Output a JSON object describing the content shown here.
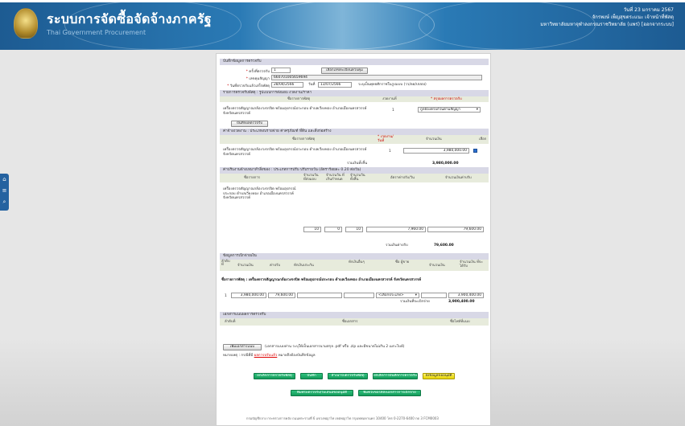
{
  "header": {
    "title": "ระบบการจัดซื้อจัดจ้างภาครัฐ",
    "subtitle": "Thai Government Procurement",
    "date_line": "วันที่ 23 มกราคม 2567",
    "user_line": "จักรพงษ์ เพ็ญสุขตระแนะ  เจ้าหน้าที่พัสดุ",
    "org_line": "มหาวิทยาลัยมหาจุฬาลงกรณราชวิทยาลัย (แพร่) [ออกจากระบบ]"
  },
  "side_tab": {
    "home": "⌂",
    "menu": "≡",
    "search": "⌕"
  },
  "record": {
    "section_title": "บันทึกข้อมูลการตรวจรับ",
    "round_label": "ครั้งที่ตรวจรับ",
    "round_value": "1",
    "select_btn": "เลือกเลขทะเบียนควบคุม",
    "contract_label": "เลขคุมสัญญา",
    "contract_value": "660701005659694",
    "date_label": "วันที่ตรวจรับแล้วเสร็จพัสดุ",
    "date_value": "28/04/2566",
    "date2_label": "วันที่",
    "date2_value": "13/07/2566",
    "date_note": "ระบุเป็นพุทธศักราชในรูปแบบ (วว/ดด/ปปปป)"
  },
  "inspect": {
    "title": "รายการตรวจรับพัสดุ : รูปแบบการส่งมอบ งวดงาน/ราคา",
    "col_item": "ชื่อรายการพัสดุ",
    "col_qty": "งวดงานที่",
    "col_status": "* สรุปผลการตรวจรับ",
    "item": "เครื่องตรวจสัญญาณกล้องวงจรปิด พร้อมอุปกรณ์ประกอบ ตำบลเวียงทอง อำเภอเมืองนครสวรรค์ จังหวัดนครสวรรค์",
    "qty": "1",
    "status": "ถูกต้องครบถ้วนตามสัญญา",
    "save_btn": "บันทึกผลตรวจรับ"
  },
  "amount": {
    "title": "ค่าจ้างงวดงาน : ประเภทงบรายจ่าย ค่าครุภัณฑ์ ที่ดิน และสิ่งก่อสร้าง",
    "col_item": "ชื่อรายการพัสดุ",
    "col_round": "* งวดงาน/วันที่",
    "col_amount": "จำนวนเงิน",
    "col_check": "เลือก",
    "item": "เครื่องตรวจสัญญาณกล้องวงจรปิด พร้อมอุปกรณ์ประกอบ ตำบลเวียงทอง อำเภอเมืองนครสวรรค์ จังหวัดนครสวรรค์",
    "round": "1",
    "value": "3,980,000.00",
    "total_label": "รวมเงินทั้งสิ้น",
    "total": "3,980,000.00"
  },
  "fine": {
    "title": "ค่าปรับงานจ้างเหมาทำสิ่งของ : ประเภทการปรับ ปรับรายวัน (อัตราร้อยละ 0.20 ต่อวัน)",
    "col_item": "ชื่อรายการ",
    "col_a": "จำนวนวัน ที่ส่งมอบ",
    "col_b": "จำนวนวัน ที่เกินกำหนด",
    "col_c": "จำนวนวัน ทั้งสิ้น",
    "col_rate": "อัตราค่าปรับ/วัน",
    "col_total": "จำนวนเงินค่าปรับ",
    "item": "เครื่องตรวจสัญญาณกล้องวงจรปิด พร้อมอุปกรณ์ประกอบ ตำบลเวียงทอง อำเภอเมืองนครสวรรค์ จังหวัดนครสวรรค์",
    "a": "10",
    "b": "0",
    "c": "10",
    "rate": "7,960.00",
    "total": "79,600.00",
    "total_label": "รวมเงินค่าปรับ",
    "total_value": "79,600.00"
  },
  "pay": {
    "title": "ข้อมูลการเบิกจ่ายเงิน",
    "col_no": "ลำดับ ที่",
    "col_amount": "จำนวนเงิน",
    "col_fine": "ค่าปรับ",
    "col_deduct": "หักเงินประกัน",
    "col_other": "หักเงินอื่นๆ",
    "col_vendor": "ชื่อ ผู้ขาย",
    "col_net": "จำนวนเงิน",
    "col_receive": "จำนวนเงิน ที่จะได้รับ",
    "item_line": "ชื่อรายการพัสดุ : เครื่องตรวจสัญญาณกล้องวงจรปิด พร้อมอุปกรณ์ประกอบ ตำบลเวียงทอง อำเภอเมืองนครสวรรค์ จังหวัดนครสวรรค์",
    "no": "1",
    "amount": "3,980,000.00",
    "fine": "79,600.00",
    "vendor": "<เลือกประเภท>",
    "receive": "3,900,400.00",
    "total_label": "รวมเงินที่จะเบิกจ่าย",
    "total": "3,900,400.00"
  },
  "docs": {
    "title": "เอกสารแนบผลการตรวจรับ",
    "col_no": "ลำดับที่",
    "col_name": "ชื่อเอกสาร",
    "col_file": "ชื่อไฟล์ที่แนบ",
    "attach_btn": "เพิ่มเอกสารแนบ",
    "attach_note": "(เอกสารแนบท่าน ระบุให้เป็นเอกสารนามสกุล .pdf หรือ .zip และมีขนาดไม่เกิน 2 เมกะไบต์)",
    "note_prefix": "หมายเหตุ : กรณีที่มี",
    "note_link": "ผลการปรับแล้ว",
    "note_suffix": "หมายถึงต้องบันทึกข้อมูล"
  },
  "actions": {
    "b1": "ยกเลิกการตรวจรับพัสดุ",
    "b2": "บันทึก",
    "b3": "สำเนาใบตรวจรับพัสดุ",
    "b4": "ยกเลิกการบันทึกการตรวจรับ",
    "b5": "ส่งข้อมูลขออนุมัติ",
    "b6": "พิมพ์ใบตรวจรับ/ใบเสนอขออนุมัติ",
    "b7": "พิมพ์ใบขอให้ส่งเอกสารการเบิกจ่าย"
  },
  "footer": "กรมบัญชีกลาง กระทรวงการคลัง ถนนพระรามที่ 6 แขวงพญาไท เขตพญาไท กรุงเทพมหานคร 10400 โทร 0-2270-6400 กด 3    FCM0003"
}
